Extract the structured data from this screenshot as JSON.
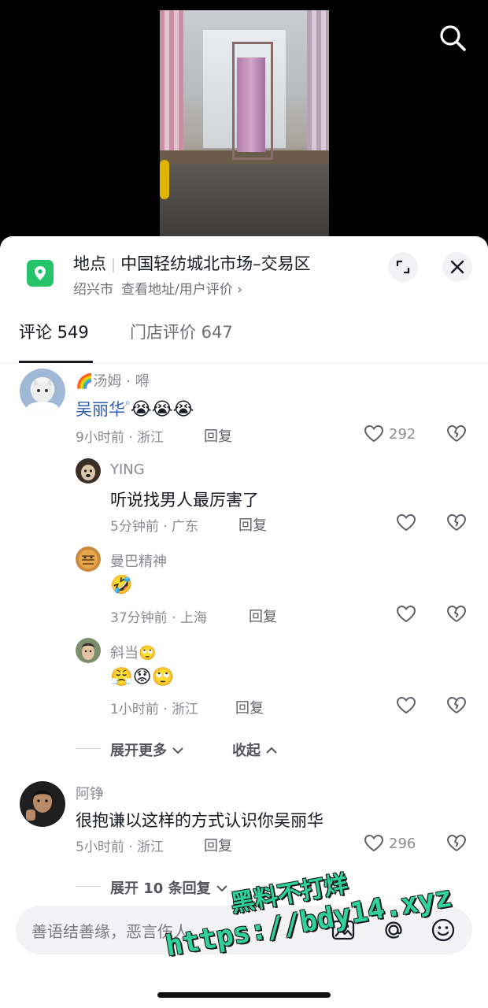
{
  "location": {
    "label": "地点",
    "name": "中国轻纺城北市场–交易区",
    "city": "绍兴市",
    "link": "查看地址/用户评价",
    "chevron": "›"
  },
  "tabs": [
    {
      "label": "评论 549"
    },
    {
      "label": "门店评价 647"
    }
  ],
  "comments": [
    {
      "username_prefix": "🌈",
      "username": "汤姆 · 嘚",
      "mention": "吴丽华",
      "emojis": "😭😭😭",
      "meta": "9小时前 · 浙江",
      "reply": "回复",
      "likes": "292"
    },
    {
      "username": "YING",
      "text": "听说找男人最厉害了",
      "meta": "5分钟前 · 广东",
      "reply": "回复"
    },
    {
      "username": "曼巴精神",
      "emojis": "🤣",
      "meta": "37分钟前 · 上海",
      "reply": "回复"
    },
    {
      "username": "斜当🙄",
      "emojis": "😤😟🙄",
      "meta": "1小时前 · 浙江",
      "reply": "回复"
    },
    {
      "username": "阿铮",
      "text": "很抱谦以这样的方式认识你吴丽华",
      "meta": "5小时前 · 浙江",
      "reply": "回复",
      "likes": "296"
    }
  ],
  "expand": {
    "more": "展开更多",
    "collapse": "收起",
    "more_replies": "展开 10 条回复"
  },
  "input": {
    "placeholder": "善语结善缘，恶言伤人"
  },
  "watermark": {
    "line1": "黑料不打烊",
    "line2": "https://bdy14.xyz"
  },
  "colors": {
    "accent_green": "#25c46a",
    "mention_blue": "#2f5fb3",
    "watermark_green": "#2fd29a"
  }
}
